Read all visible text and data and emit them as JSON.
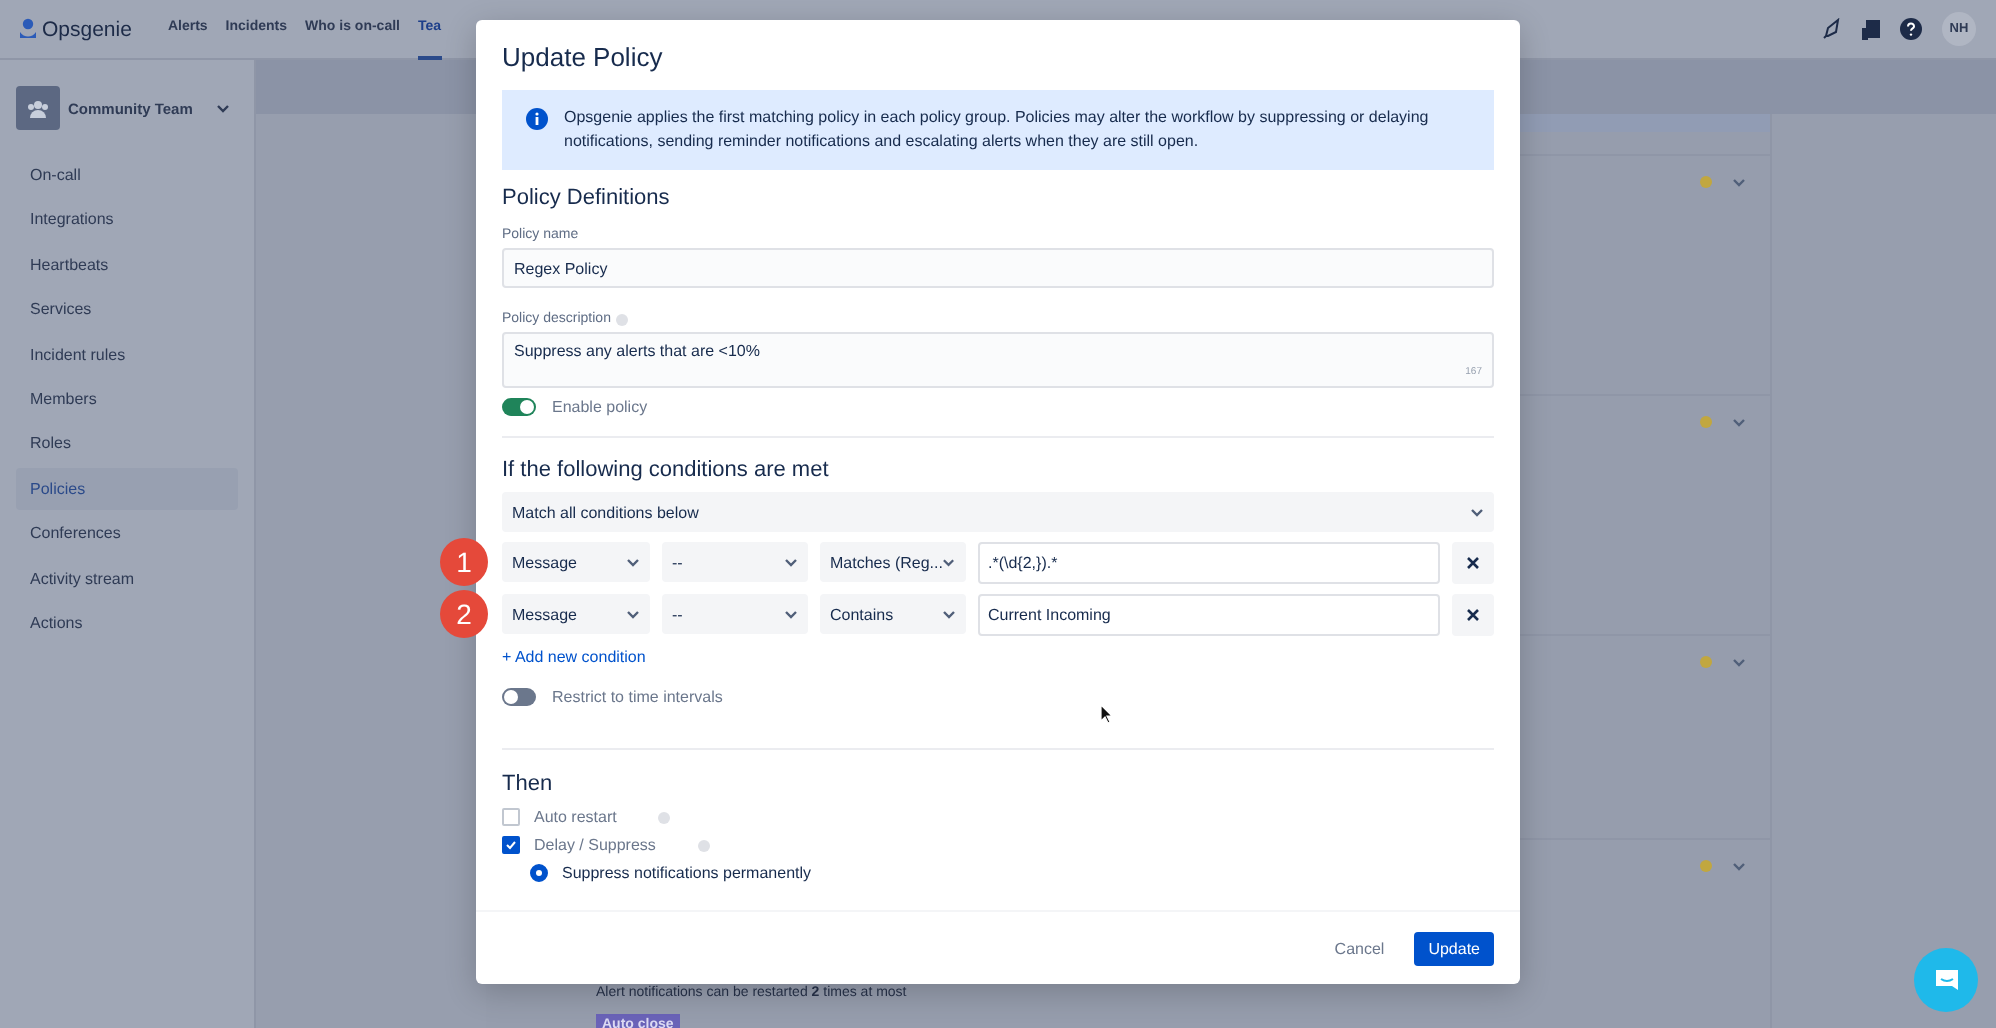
{
  "top_nav": {
    "logo": "Opsgenie",
    "items": [
      {
        "label": "Alerts",
        "selected": false
      },
      {
        "label": "Incidents",
        "selected": false
      },
      {
        "label": "Who is on-call",
        "selected": false
      },
      {
        "label": "Tea",
        "selected": true
      }
    ],
    "avatar": "NH"
  },
  "sidebar": {
    "team": "Community Team",
    "items": [
      {
        "label": "On-call",
        "selected": false
      },
      {
        "label": "Integrations",
        "selected": false
      },
      {
        "label": "Heartbeats",
        "selected": false
      },
      {
        "label": "Services",
        "selected": false
      },
      {
        "label": "Incident rules",
        "selected": false
      },
      {
        "label": "Members",
        "selected": false
      },
      {
        "label": "Roles",
        "selected": false
      },
      {
        "label": "Policies",
        "selected": true
      },
      {
        "label": "Conferences",
        "selected": false
      },
      {
        "label": "Activity stream",
        "selected": false
      },
      {
        "label": "Actions",
        "selected": false
      }
    ]
  },
  "policy_cards": [
    {
      "expanded": false
    },
    {
      "expanded": false
    },
    {
      "expanded": false
    },
    {
      "expanded": false,
      "note": "Alert notifications can be restarted **2** times at most",
      "tag": "Auto close"
    }
  ],
  "modal": {
    "title": "Update Policy",
    "info": "Opsgenie applies the first matching policy in each policy group. Policies may alter the workflow by suppressing or delaying notifications, sending reminder notifications and escalating alerts when they are still open.",
    "section_title": "Policy Definitions",
    "name_label": "Policy name",
    "name_value": "Regex Policy",
    "description_label": "Policy description",
    "description_value": "Suppress any alerts that are <10%",
    "char_count": "167",
    "enable": {
      "label": "Enable policy",
      "on": true
    },
    "conditions_title": "If the following conditions are met",
    "match": "Match all conditions below",
    "conditions": [
      {
        "marker": "1",
        "field": "Message",
        "sub_field": "--",
        "operator": "Matches (Reg...",
        "value": ".*(\\d{2,}).*"
      },
      {
        "marker": "2",
        "field": "Message",
        "sub_field": "--",
        "operator": "Contains",
        "value": "Current Incoming"
      }
    ],
    "add_condition": "+ Add new condition",
    "restrict": {
      "label": "Restrict to time intervals",
      "on": false
    },
    "then_title": "Then",
    "actions": [
      {
        "kind": "checkbox",
        "label": "Auto restart",
        "checked": false,
        "help": true
      },
      {
        "kind": "checkbox",
        "label": "Delay / Suppress",
        "checked": true,
        "help": true
      },
      {
        "kind": "radio",
        "label": "Suppress notifications permanently",
        "selected": true
      }
    ],
    "cancel": "Cancel",
    "update": "Update"
  }
}
